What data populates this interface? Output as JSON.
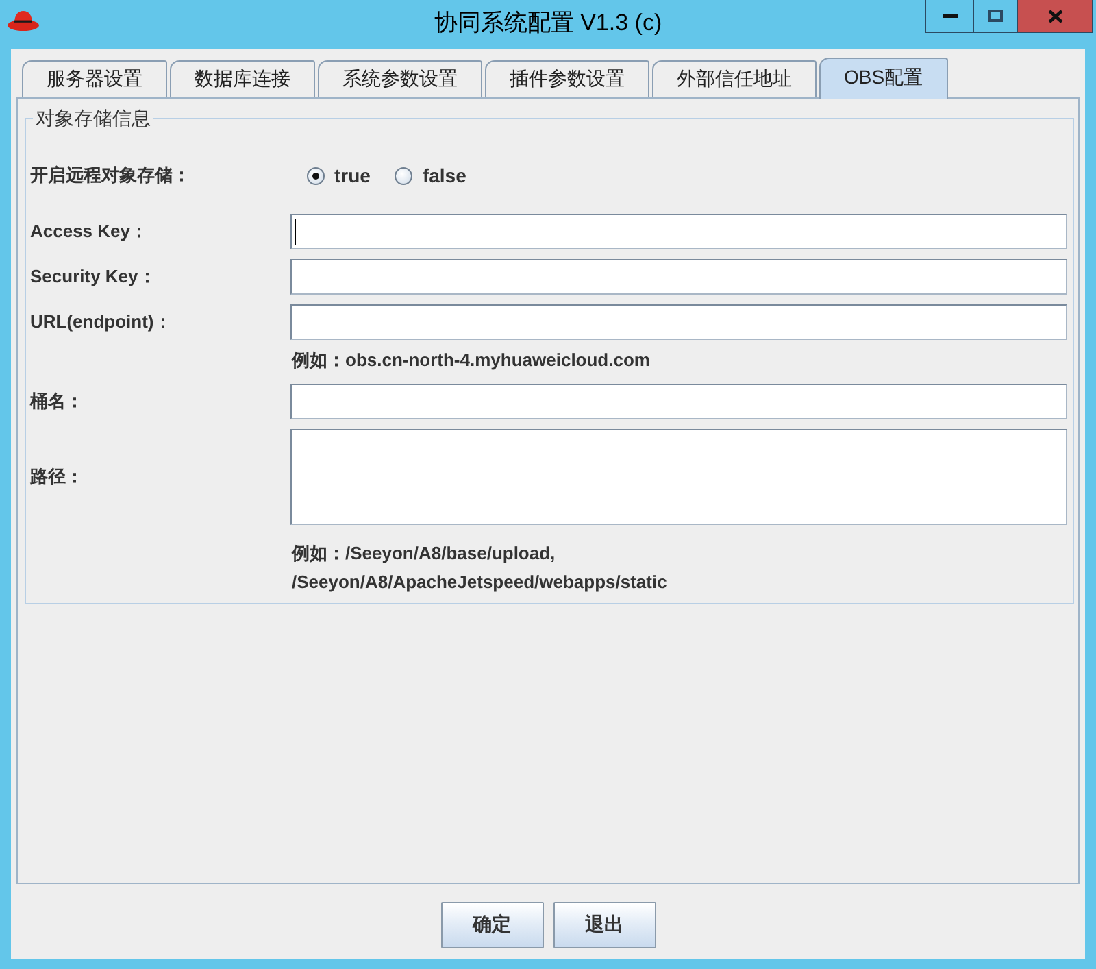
{
  "window": {
    "title": "协同系统配置 V1.3 (c)"
  },
  "tabs": [
    {
      "label": "服务器设置",
      "selected": false
    },
    {
      "label": "数据库连接",
      "selected": false
    },
    {
      "label": "系统参数设置",
      "selected": false
    },
    {
      "label": "插件参数设置",
      "selected": false
    },
    {
      "label": "外部信任地址",
      "selected": false
    },
    {
      "label": "OBS配置",
      "selected": true
    }
  ],
  "panel": {
    "group_title": "对象存储信息",
    "remote_storage": {
      "label": "开启远程对象存储：",
      "options": [
        {
          "label": "true",
          "selected": true
        },
        {
          "label": "false",
          "selected": false
        }
      ]
    },
    "fields": [
      {
        "label": "Access Key：",
        "kind": "text",
        "focused": true
      },
      {
        "label": "Security Key：",
        "kind": "text",
        "focused": false
      },
      {
        "label": "URL(endpoint)：",
        "kind": "text",
        "focused": false,
        "hint_lines": [
          "例如：obs.cn-north-4.myhuaweicloud.com"
        ]
      },
      {
        "label": "桶名：",
        "kind": "text",
        "focused": false
      },
      {
        "label": "路径：",
        "kind": "textarea",
        "focused": false,
        "hint_lines": [
          "例如：/Seeyon/A8/base/upload,",
          "/Seeyon/A8/ApacheJetspeed/webapps/static"
        ]
      }
    ]
  },
  "buttons": [
    "确定",
    "退出"
  ]
}
